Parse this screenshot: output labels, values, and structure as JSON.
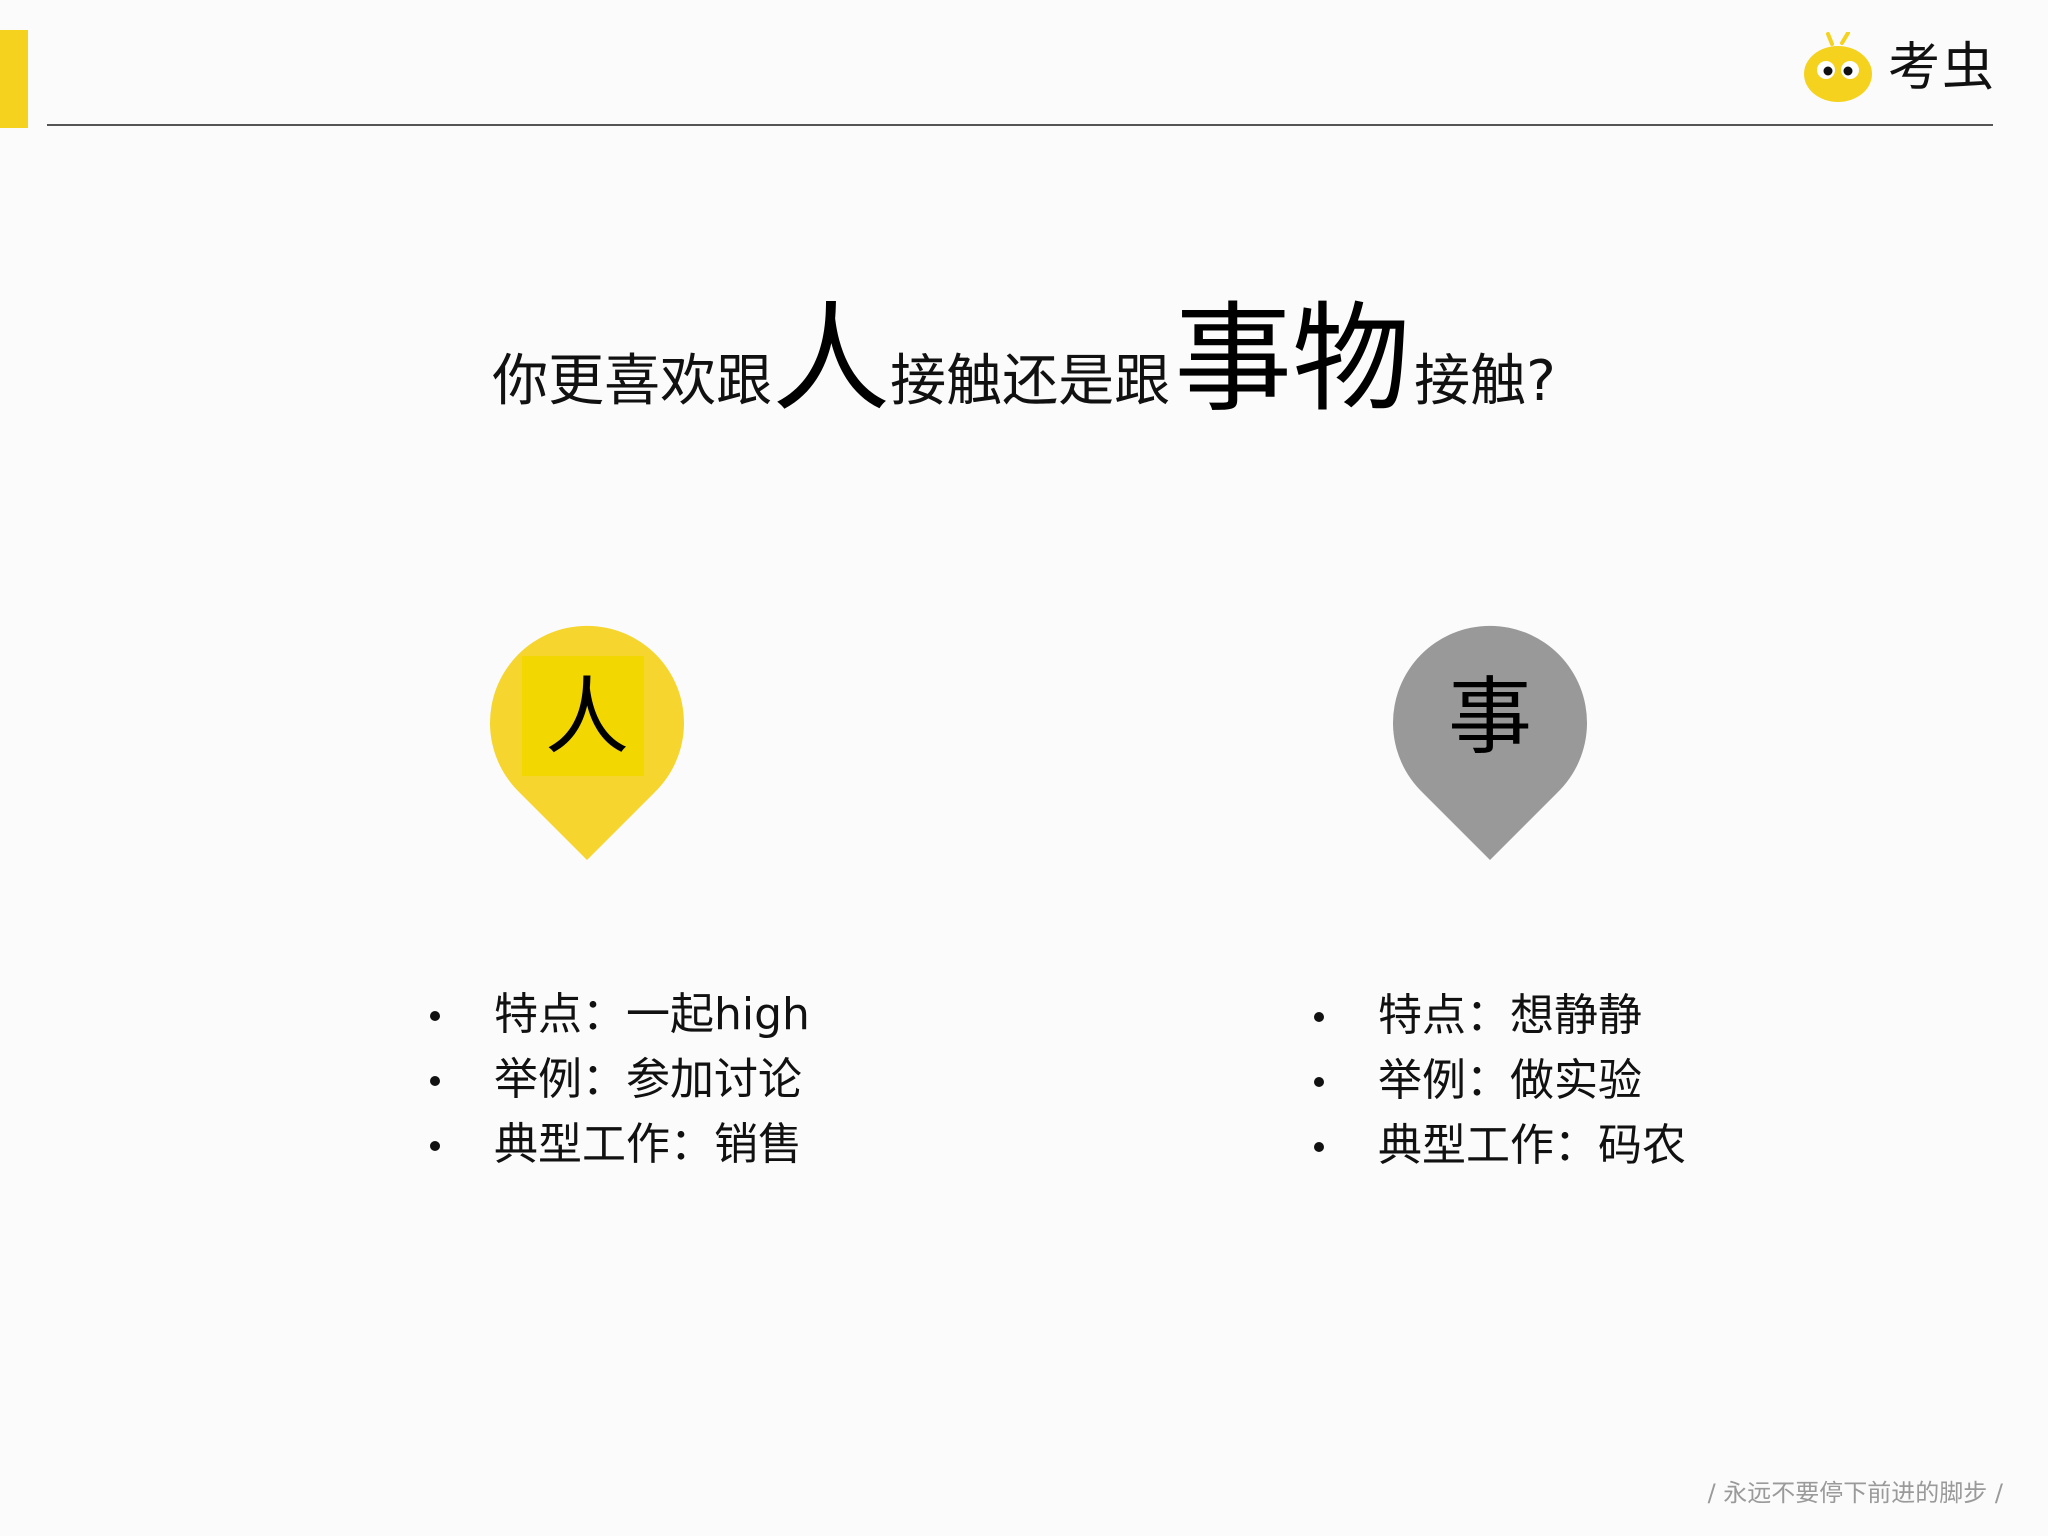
{
  "brand": {
    "name": "考虫",
    "accent_color": "#f5d21e"
  },
  "headline": {
    "part1": "你更喜欢跟",
    "emph1": "人",
    "part2": "接触还是跟",
    "emph2": "事物",
    "part3": "接触?"
  },
  "left_card": {
    "symbol": "人",
    "color": "#f5d52e",
    "items": [
      "特点：一起high",
      "举例：参加讨论",
      "典型工作：销售"
    ]
  },
  "right_card": {
    "symbol": "事",
    "color": "#999999",
    "items": [
      "特点：想静静",
      "举例：做实验",
      "典型工作：码农"
    ]
  },
  "footer": {
    "slogan": "/ 永远不要停下前进的脚步 /"
  }
}
